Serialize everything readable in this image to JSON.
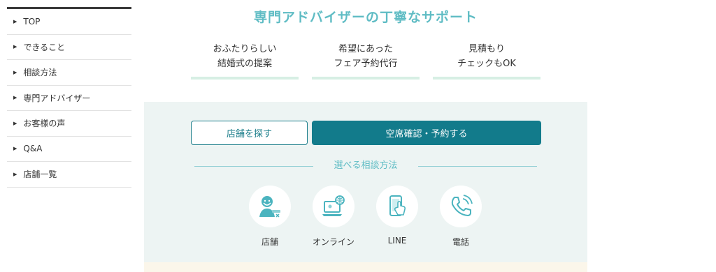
{
  "sidebar": {
    "items": [
      {
        "label": "TOP"
      },
      {
        "label": "できること"
      },
      {
        "label": "相談方法"
      },
      {
        "label": "専門アドバイザー"
      },
      {
        "label": "お客様の声"
      },
      {
        "label": "Q&A"
      },
      {
        "label": "店舗一覧"
      }
    ]
  },
  "main": {
    "title": "専門アドバイザーの丁寧なサポート",
    "features": [
      {
        "line1": "おふたりらしい",
        "line2": "結婚式の提案"
      },
      {
        "line1": "希望にあった",
        "line2": "フェア予約代行"
      },
      {
        "line1": "見積もり",
        "line2": "チェックもOK"
      }
    ],
    "buttons": {
      "find_store": "店舗を探す",
      "reserve": "空席確認・予約する"
    },
    "consult_heading": "選べる相談方法",
    "methods": [
      {
        "label": "店舗",
        "icon": "consultant-icon"
      },
      {
        "label": "オンライン",
        "icon": "laptop-globe-icon"
      },
      {
        "label": "LINE",
        "icon": "smartphone-tap-icon"
      },
      {
        "label": "電話",
        "icon": "phone-icon"
      }
    ]
  },
  "colors": {
    "accent": "#127b8b",
    "title": "#5fbcc4",
    "panel_bg": "#edf4f3",
    "feature_underline": "#d7efe4",
    "icon": "#4bb4bf"
  }
}
